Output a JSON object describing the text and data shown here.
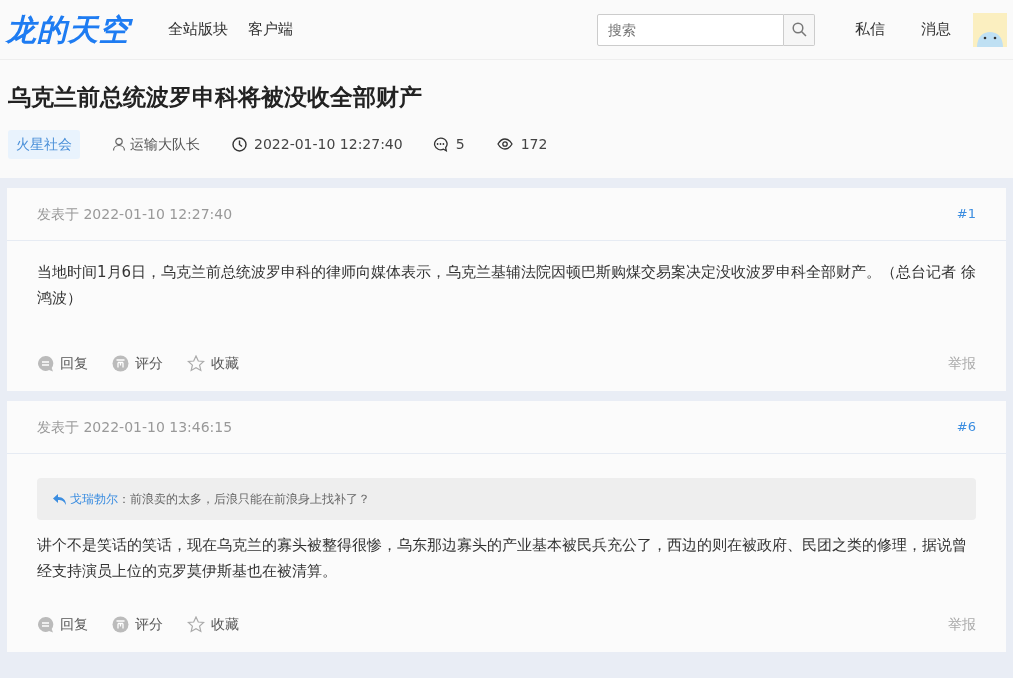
{
  "header": {
    "logo": "龙的天空",
    "nav": [
      "全站版块",
      "客户端"
    ],
    "search": {
      "placeholder": "搜索"
    },
    "links": [
      "私信",
      "消息"
    ]
  },
  "thread": {
    "title": "乌克兰前总统波罗申科将被没收全部财产",
    "forum": "火星社会",
    "author": "运输大队长",
    "time": "2022-01-10 12:27:40",
    "replies": "5",
    "views": "172"
  },
  "posts": [
    {
      "posted": "发表于 2022-01-10 12:27:40",
      "floor": "#1",
      "body": "当地时间1月6日，乌克兰前总统波罗申科的律师向媒体表示，乌克兰基辅法院因顿巴斯购煤交易案决定没收波罗申科全部财产。（总台记者 徐鸿波）",
      "actions": [
        "回复",
        "评分",
        "收藏"
      ],
      "report": "举报"
    },
    {
      "posted": "发表于 2022-01-10 13:46:15",
      "floor": "#6",
      "quote": {
        "author": "戈瑞勃尔",
        "text": "：前浪卖的太多，后浪只能在前浪身上找补了？"
      },
      "body": "讲个不是笑话的笑话，现在乌克兰的寡头被整得很惨，乌东那边寡头的产业基本被民兵充公了，西边的则在被政府、民团之类的修理，据说曾经支持演员上位的克罗莫伊斯基也在被清算。",
      "actions": [
        "回复",
        "评分",
        "收藏"
      ],
      "report": "举报"
    }
  ]
}
